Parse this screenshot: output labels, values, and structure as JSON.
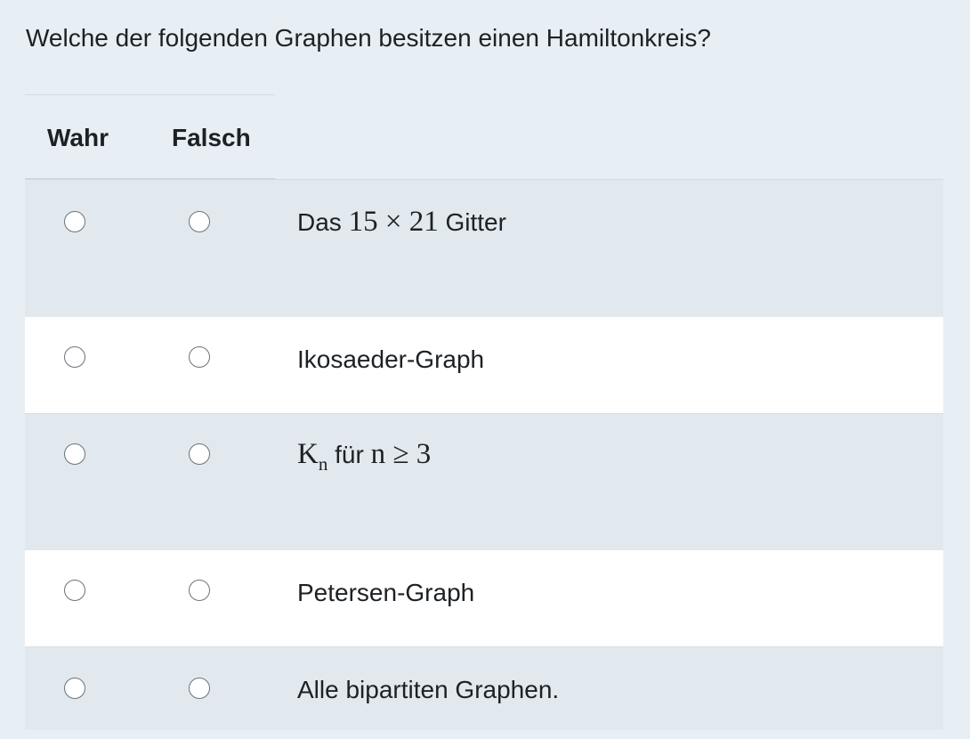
{
  "question": "Welche der folgenden Graphen besitzen einen Hamiltonkreis?",
  "columns": {
    "true_label": "Wahr",
    "false_label": "Falsch"
  },
  "statements": [
    {
      "prefix": "Das",
      "math": "15 × 21",
      "suffix": "Gitter",
      "selected": null
    },
    {
      "text": "Ikosaeder-Graph",
      "selected": null
    },
    {
      "math_base": "K",
      "math_sub": "n",
      "text_mid": "für",
      "math_rest": "n ≥ 3",
      "selected": null
    },
    {
      "text": "Petersen-Graph",
      "selected": null
    },
    {
      "text": "Alle bipartiten Graphen.",
      "selected": null
    }
  ]
}
